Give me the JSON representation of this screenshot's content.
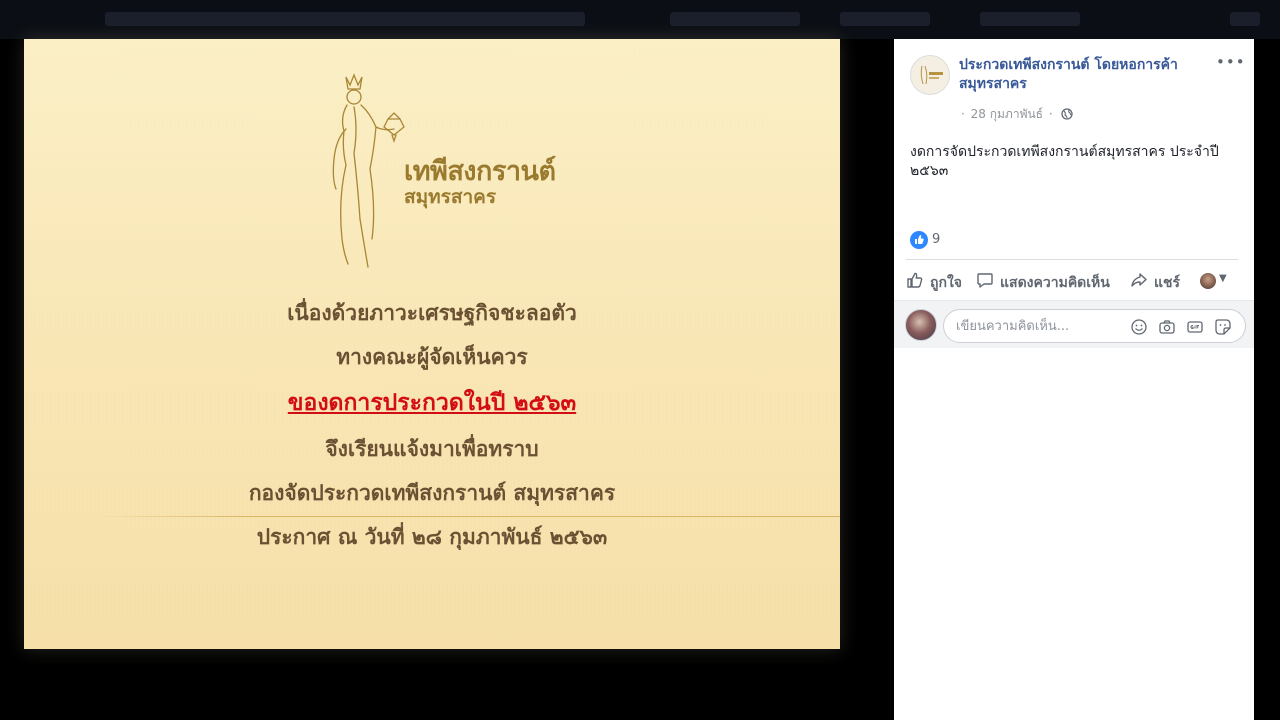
{
  "photo": {
    "logo_title": "เทพีสงกรานต์",
    "logo_sub": "สมุทรสาคร",
    "announcement": [
      "เนื่องด้วยภาวะเศรษฐกิจชะลอตัว",
      "ทางคณะผู้จัดเห็นควร",
      "ของดการประกวดในปี ๒๕๖๓",
      "จึงเรียนแจ้งมาเพื่อทราบ",
      "กองจัดประกวดเทพีสงกรานต์ สมุทรสาคร",
      "ประกาศ ณ วันที่ ๒๘ กุมภาพันธ์ ๒๕๖๓"
    ]
  },
  "post": {
    "page_name": "ประกวดเทพีสงกรานต์ โดยหอการค้าสมุทรสาคร",
    "more_label": "•••",
    "date": "28 กุมภาพันธ์",
    "privacy_icon": "globe-icon",
    "text": "งดการจัดประกวดเทพีสงกรานต์สมุทรสาคร ประจำปี ๒๕๖๓",
    "reactions": {
      "icon": "like-icon",
      "count": "9"
    },
    "actions": {
      "like": "ถูกใจ",
      "comment": "แสดงความคิดเห็น",
      "share": "แชร์"
    },
    "comment": {
      "placeholder": "เขียนความคิดเห็น...",
      "icons": [
        "emoji-icon",
        "camera-icon",
        "gif-icon",
        "sticker-icon"
      ]
    }
  },
  "colors": {
    "link": "#385898",
    "accent": "#2d88ff",
    "announcement_text": "#6b5133",
    "announcement_highlight": "#d40d12",
    "gold": "#9a7a2e"
  }
}
